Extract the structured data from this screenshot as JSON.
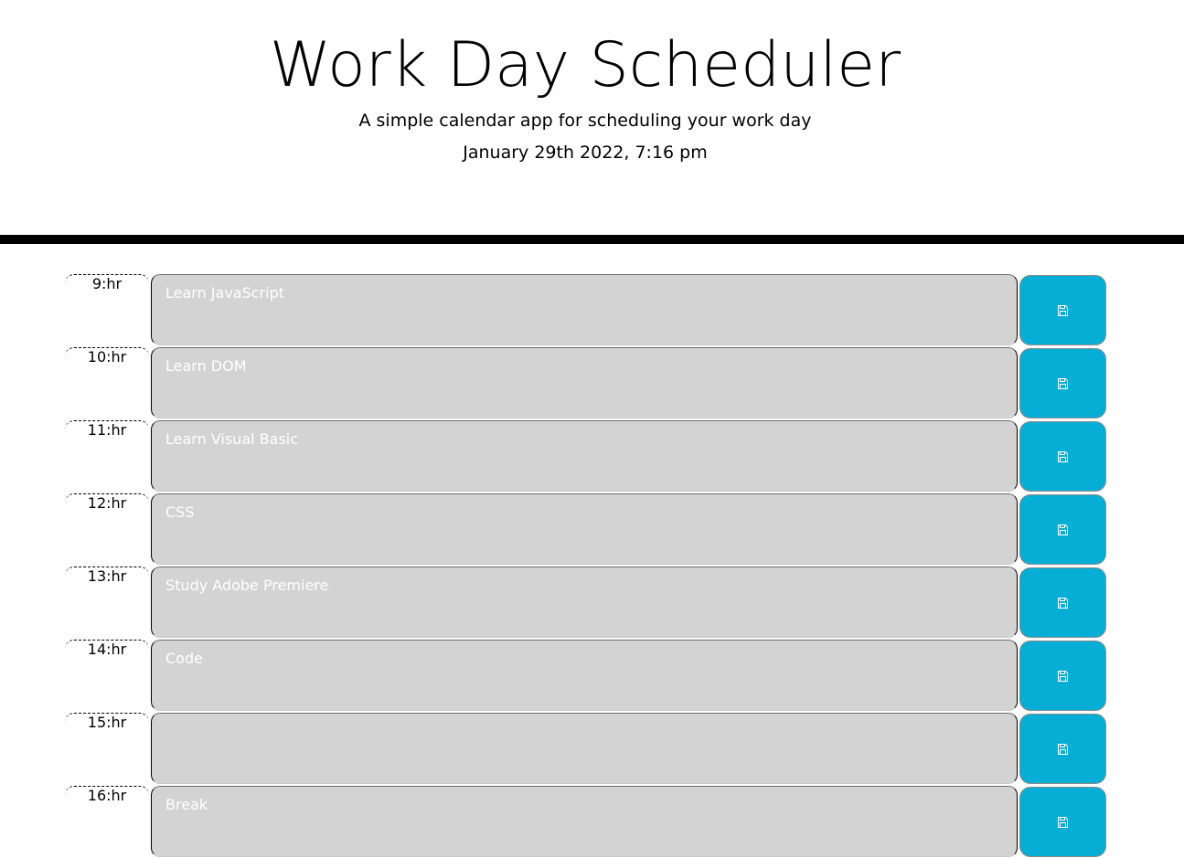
{
  "header": {
    "title": "Work Day Scheduler",
    "subtitle": "A simple calendar app for scheduling your work day",
    "current_day": "January 29th 2022, 7:16 pm"
  },
  "colors": {
    "past": "#d3d3d3",
    "save_button": "#06aed5",
    "task_text": "#ffffff"
  },
  "rows": [
    {
      "hour": "9:hr",
      "task": "Learn JavaScript",
      "save_icon": "floppy-disk-icon"
    },
    {
      "hour": "10:hr",
      "task": "Learn DOM",
      "save_icon": "floppy-disk-icon"
    },
    {
      "hour": "11:hr",
      "task": "Learn Visual Basic",
      "save_icon": "floppy-disk-icon"
    },
    {
      "hour": "12:hr",
      "task": "CSS",
      "save_icon": "floppy-disk-icon"
    },
    {
      "hour": "13:hr",
      "task": "Study Adobe Premiere",
      "save_icon": "floppy-disk-icon"
    },
    {
      "hour": "14:hr",
      "task": "Code",
      "save_icon": "floppy-disk-icon"
    },
    {
      "hour": "15:hr",
      "task": "",
      "save_icon": "floppy-disk-icon"
    },
    {
      "hour": "16:hr",
      "task": "Break",
      "save_icon": "floppy-disk-icon"
    }
  ]
}
